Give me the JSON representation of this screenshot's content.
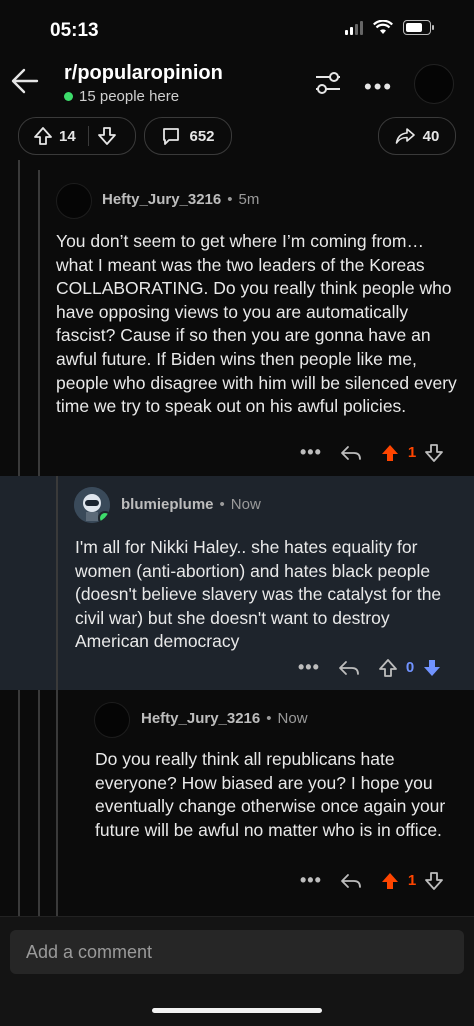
{
  "status": {
    "time": "05:13"
  },
  "header": {
    "subreddit": "r/popularopinion",
    "online_text": "15 people here"
  },
  "post_actions": {
    "votes": "14",
    "comments": "652",
    "shares": "40"
  },
  "comments": [
    {
      "username": "Hefty_Jury_3216",
      "age": "5m",
      "body": "You don’t seem to get where I’m coming from… what I meant was the two leaders of the Koreas COLLABORATING. Do you really think people who have opposing views to you are automatically fascist? Cause if so then you are gonna have an awful future. If Biden wins then people like me, people who disagree with him will be silenced every time we try to speak out on his awful policies.",
      "score": "1",
      "vote_state": "upvoted"
    },
    {
      "username": "blumieplume",
      "age": "Now",
      "body": "I'm all for Nikki Haley.. she hates equality for women (anti-abortion) and hates black people (doesn't believe slavery was the catalyst for the civil war) but she doesn't want to destroy American democracy",
      "score": "0",
      "vote_state": "downvoted"
    },
    {
      "username": "Hefty_Jury_3216",
      "age": "Now",
      "body": "Do you really think all republicans hate everyone? How biased are you? I hope you eventually change otherwise once again your future will be awful no matter who is in office.",
      "score": "1",
      "vote_state": "upvoted"
    }
  ],
  "composer": {
    "placeholder": "Add a comment"
  },
  "colors": {
    "upvote": "#ff4500",
    "downvote": "#7193ff",
    "online": "#3ddc6b",
    "highlight_bg": "#1e242c"
  }
}
